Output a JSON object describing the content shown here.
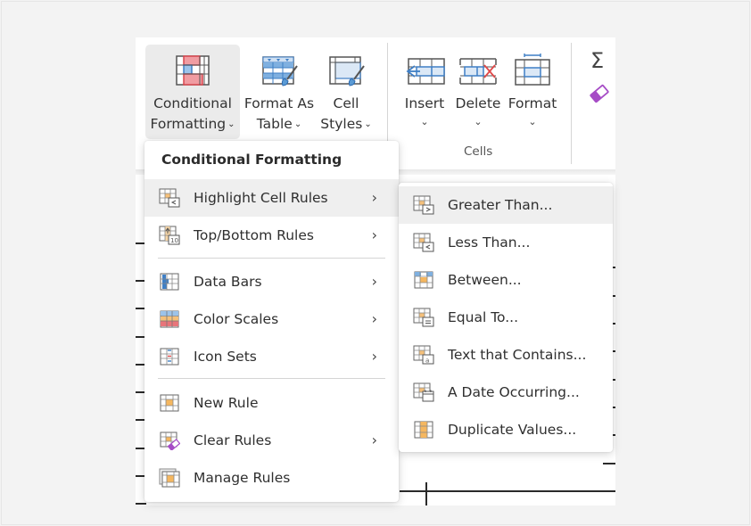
{
  "ribbon": {
    "styles_group": {
      "buttons": [
        {
          "line1": "Conditional",
          "line2": "Formatting",
          "icon": "conditional-formatting-icon",
          "active": true
        },
        {
          "line1": "Format As",
          "line2": "Table",
          "icon": "format-as-table-icon"
        },
        {
          "line1": "Cell",
          "line2": "Styles",
          "icon": "cell-styles-icon"
        }
      ]
    },
    "cells_group": {
      "label": "Cells",
      "buttons": [
        {
          "label": "Insert",
          "icon": "insert-cells-icon"
        },
        {
          "label": "Delete",
          "icon": "delete-cells-icon"
        },
        {
          "label": "Format",
          "icon": "format-cells-icon"
        }
      ]
    },
    "editing_group": {
      "autosum_icon": "sigma-icon",
      "clear_icon": "eraser-icon"
    },
    "chevron": "⌄"
  },
  "cf_menu": {
    "title": "Conditional Formatting",
    "items": [
      {
        "label": "Highlight Cell Rules",
        "icon": "highlight-cell-rules-icon",
        "submenu": true,
        "hover": true
      },
      {
        "label": "Top/Bottom Rules",
        "icon": "top-bottom-rules-icon",
        "submenu": true
      },
      {
        "label": "Data Bars",
        "icon": "data-bars-icon",
        "submenu": true
      },
      {
        "label": "Color Scales",
        "icon": "color-scales-icon",
        "submenu": true
      },
      {
        "label": "Icon Sets",
        "icon": "icon-sets-icon",
        "submenu": true
      },
      {
        "label": "New Rule",
        "icon": "new-rule-icon",
        "submenu": false
      },
      {
        "label": "Clear Rules",
        "icon": "clear-rules-icon",
        "submenu": true
      },
      {
        "label": "Manage Rules",
        "icon": "manage-rules-icon",
        "submenu": false
      }
    ],
    "arrow": "›"
  },
  "highlight_submenu": {
    "items": [
      {
        "label": "Greater Than...",
        "icon": "greater-than-icon",
        "hover": true
      },
      {
        "label": "Less Than...",
        "icon": "less-than-icon"
      },
      {
        "label": "Between...",
        "icon": "between-icon"
      },
      {
        "label": "Equal To...",
        "icon": "equal-to-icon"
      },
      {
        "label": "Text that Contains...",
        "icon": "text-contains-icon"
      },
      {
        "label": "A Date Occurring...",
        "icon": "date-occurring-icon"
      },
      {
        "label": "Duplicate Values...",
        "icon": "duplicate-values-icon"
      }
    ]
  },
  "colors": {
    "accent_red": "#e8757a",
    "accent_blue": "#4a86c8",
    "accent_orange": "#f0a030",
    "accent_purple": "#a64cc6"
  }
}
